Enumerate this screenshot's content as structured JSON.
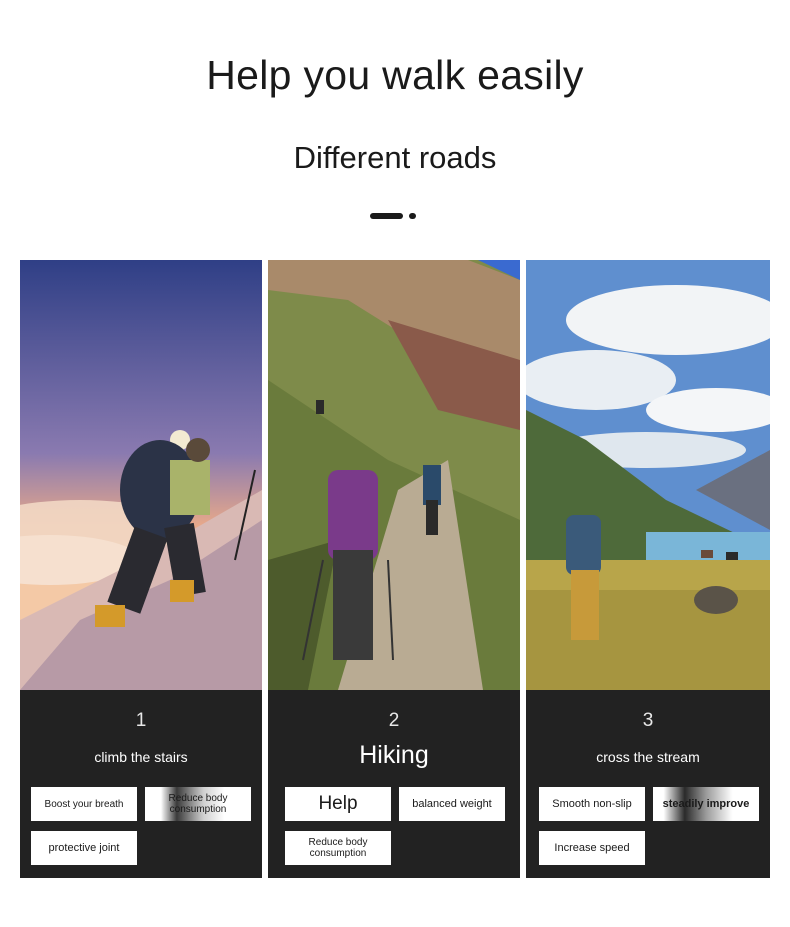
{
  "headline": "Help you walk easily",
  "subline": "Different roads",
  "cards": [
    {
      "number": "1",
      "title": "climb the stairs",
      "chips": [
        "Boost your breath",
        "Reduce body consumption",
        "protective joint"
      ]
    },
    {
      "number": "2",
      "title": "Hiking",
      "chips": [
        "Help",
        "balanced weight",
        "Reduce body consumption"
      ]
    },
    {
      "number": "3",
      "title": "cross the stream",
      "chips": [
        "Smooth non-slip",
        "steadily improve",
        "Increase speed"
      ]
    }
  ],
  "colors": {
    "panel": "#222222",
    "text_dark": "#1a1a1a",
    "chip": "#ffffff"
  }
}
